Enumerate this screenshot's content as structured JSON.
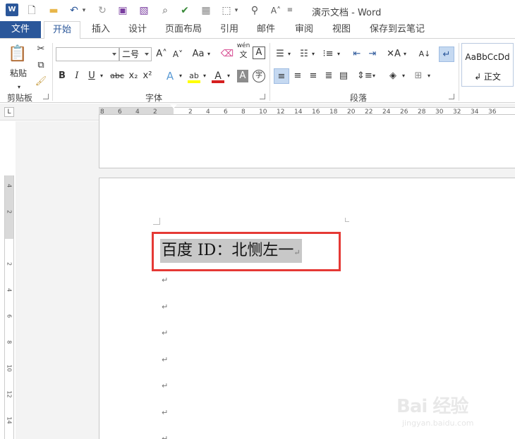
{
  "window": {
    "title": "演示文档 - Word",
    "app_logo": "W"
  },
  "quick_access": {
    "icons": [
      "word-logo-icon",
      "new-document-icon",
      "open-folder-icon",
      "undo-icon",
      "redo-icon",
      "save-icon",
      "save-as-icon",
      "print-preview-icon",
      "spellcheck-icon",
      "table-icon",
      "border-icon",
      "find-icon",
      "font-size-icon",
      "customize-icon"
    ]
  },
  "tabs": {
    "file": "文件",
    "items": [
      "开始",
      "插入",
      "设计",
      "页面布局",
      "引用",
      "邮件",
      "审阅",
      "视图",
      "保存到云笔记"
    ],
    "active": "开始"
  },
  "ribbon": {
    "clipboard": {
      "paste_label": "粘贴",
      "group_label": "剪贴板"
    },
    "font": {
      "font_name": "",
      "font_size": "二号",
      "bold": "B",
      "italic": "I",
      "underline": "U",
      "strikethrough": "abc",
      "subscript": "x₂",
      "superscript": "x²",
      "change_case": "Aa",
      "phonetic_top": "wén",
      "phonetic_bottom": "文",
      "char_border": "A",
      "char_shading": "A",
      "enclose_char": "字",
      "group_label": "字体"
    },
    "paragraph": {
      "group_label": "段落"
    },
    "styles": {
      "sample": "AaBbCcDd",
      "style_name": "↲ 正文"
    }
  },
  "ruler": {
    "horizontal_labels": [
      "8",
      "6",
      "4",
      "2",
      "",
      "2",
      "4",
      "6",
      "8",
      "10",
      "12",
      "14",
      "16",
      "18",
      "20",
      "22",
      "24",
      "26",
      "28",
      "30",
      "32",
      "34",
      "36"
    ],
    "vertical_labels": [
      "4",
      "2",
      "",
      "2",
      "4",
      "6",
      "8",
      "10",
      "12",
      "14"
    ],
    "tab_selector": "L"
  },
  "document": {
    "line_text": "百度 ID：北恻左一",
    "para_mark": "↵",
    "empty_paragraphs": 7
  },
  "watermark": {
    "main": "Bai 经验",
    "sub": "jingyan.baidu.com"
  },
  "colors": {
    "accent": "#2b579a",
    "highlight_box": "#e53935",
    "selection": "#c8c8c8",
    "font_color": "#d61f1f",
    "highlighter": "#ffff00"
  }
}
